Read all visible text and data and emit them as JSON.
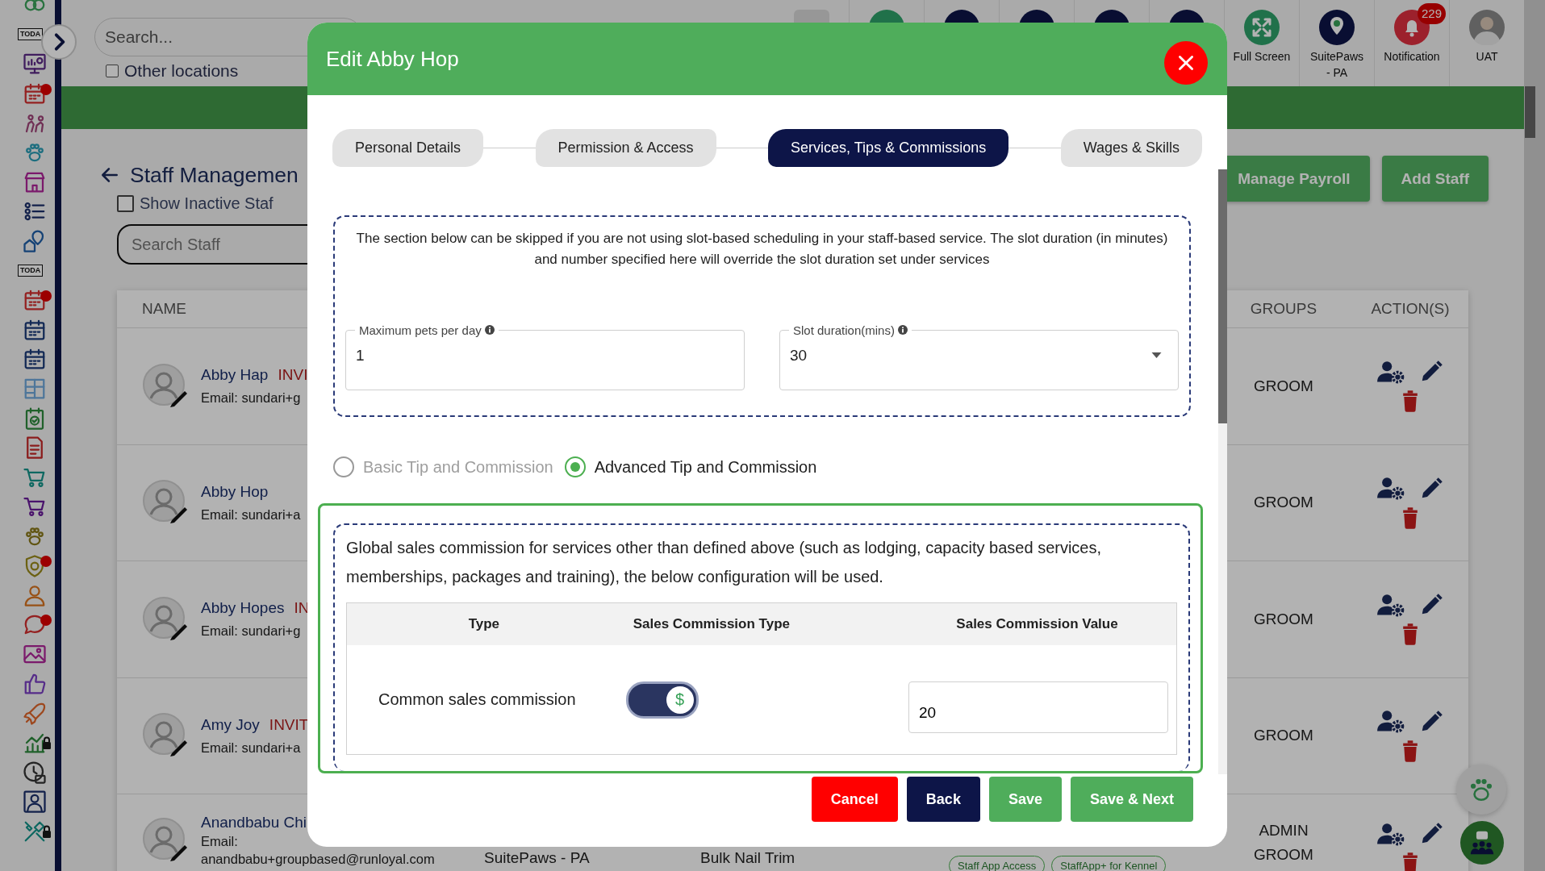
{
  "sidebar": {
    "items": [
      {
        "kind": "logo",
        "color": "#29723f",
        "alert": false,
        "locked": false
      },
      {
        "kind": "today",
        "label": "TODA",
        "color": "#0c0c0c",
        "alert": false,
        "locked": false
      },
      {
        "kind": "monitor",
        "color": "#401d5e",
        "alert": false,
        "locked": false
      },
      {
        "kind": "calendar",
        "color": "#942121",
        "alert": true,
        "locked": false
      },
      {
        "kind": "dogs",
        "color": "#703055",
        "alert": false,
        "locked": false
      },
      {
        "kind": "paw",
        "color": "#1d6e7f",
        "alert": false,
        "locked": false
      },
      {
        "kind": "shop",
        "color": "#7b1a6c",
        "alert": false,
        "locked": false
      },
      {
        "kind": "list",
        "color": "#13214b",
        "alert": false,
        "locked": false
      },
      {
        "kind": "pin",
        "color": "#164376",
        "alert": false,
        "locked": false
      },
      {
        "kind": "today",
        "label": "TODA",
        "color": "#0c0c0c",
        "alert": false,
        "locked": false
      },
      {
        "kind": "calendar",
        "color": "#942121",
        "alert": true,
        "locked": false
      },
      {
        "kind": "calendar",
        "color": "#132955",
        "alert": false,
        "locked": false
      },
      {
        "kind": "calendar",
        "color": "#132955",
        "alert": false,
        "locked": false
      },
      {
        "kind": "layout",
        "color": "#4e769a",
        "alert": false,
        "locked": false
      },
      {
        "kind": "checklist",
        "color": "#20612b",
        "alert": false,
        "locked": false
      },
      {
        "kind": "document",
        "color": "#8b1c1c",
        "alert": false,
        "locked": false
      },
      {
        "kind": "cart",
        "color": "#0e6861",
        "alert": false,
        "locked": false
      },
      {
        "kind": "cart",
        "color": "#4a136c",
        "alert": false,
        "locked": false
      },
      {
        "kind": "paw",
        "color": "#615512",
        "alert": false,
        "locked": false
      },
      {
        "kind": "shield",
        "color": "#6c6112",
        "alert": true,
        "locked": false
      },
      {
        "kind": "person",
        "color": "#985116",
        "alert": false,
        "locked": false
      },
      {
        "kind": "chat",
        "color": "#942121",
        "alert": true,
        "locked": false
      },
      {
        "kind": "image",
        "color": "#7b1a6c",
        "alert": false,
        "locked": false
      },
      {
        "kind": "thumbs",
        "color": "#562c89",
        "alert": false,
        "locked": false
      },
      {
        "kind": "rocket",
        "color": "#9d471d",
        "alert": false,
        "locked": false
      },
      {
        "kind": "chart",
        "color": "#20612b",
        "alert": false,
        "locked": true
      },
      {
        "kind": "clock",
        "color": "#242424",
        "alert": false,
        "locked": false
      },
      {
        "kind": "frame",
        "color": "#13214b",
        "alert": false,
        "locked": false
      },
      {
        "kind": "tools",
        "color": "#0e6861",
        "alert": false,
        "locked": true
      }
    ]
  },
  "topbar": {
    "search": {
      "placeholder": "Search..."
    },
    "other_locations": {
      "label": "Other locations",
      "checked": false
    },
    "tools": [
      {
        "kind": "square"
      },
      {
        "kind": "green_circle"
      },
      {
        "kind": "navy_circle"
      },
      {
        "kind": "navy_circle"
      },
      {
        "kind": "navy_circle"
      },
      {
        "kind": "navy_circle"
      },
      {
        "kind": "fullscreen",
        "label": "Full Screen"
      },
      {
        "kind": "location",
        "label": "SuitePaws - PA"
      },
      {
        "kind": "notification",
        "label": "Notification",
        "badge": "229"
      },
      {
        "kind": "avatar",
        "label": "UAT"
      }
    ]
  },
  "page": {
    "title": "Staff Managemen",
    "show_inactive": {
      "label": "Show Inactive Staf",
      "checked": false
    },
    "search": {
      "placeholder": "Search Staff"
    },
    "buttons": [
      "Manage Payroll",
      "Add Staff"
    ],
    "table": {
      "columns": [
        "NAME",
        "GROUPS",
        "ACTION(S)"
      ],
      "rows": [
        {
          "name": "Abby Hap",
          "status": "INVI",
          "email": [
            "Email: sundari+g"
          ],
          "groups": [
            "GROOM"
          ]
        },
        {
          "name": "Abby Hop",
          "email": [
            "Email: sundari+a"
          ],
          "groups": [
            "GROOM"
          ]
        },
        {
          "name": "Abby Hopes",
          "status": "IN",
          "email": [
            "Email: sundari+g"
          ],
          "groups": [
            "GROOM"
          ]
        },
        {
          "name": "Amy Joy",
          "status": "INVIT",
          "email": [
            "Email: sundari+a"
          ],
          "groups": [
            "GROOM"
          ]
        },
        {
          "name": "Anandbabu Chi",
          "email": [
            "Email:",
            "anandbabu+groupbased@runloyal.com"
          ],
          "location": "SuitePaws - PA",
          "service": "Bulk Nail Trim",
          "tags": [
            "Staff App Access",
            "StaffApp+ for Kennel"
          ],
          "groups": [
            "ADMIN",
            "GROOM"
          ]
        }
      ]
    }
  },
  "modal": {
    "title": "Edit Abby Hop",
    "tabs": [
      {
        "label": "Personal Details",
        "selected": false
      },
      {
        "label": "Permission & Access",
        "selected": false
      },
      {
        "label": "Services, Tips & Commissions",
        "selected": true
      },
      {
        "label": "Wages & Skills",
        "selected": false
      }
    ],
    "slot_note": "The section below can be skipped if you are not using slot-based scheduling in your staff-based service. The slot duration (in minutes) and number specified here will override the slot duration set under services",
    "max_pets": {
      "label": "Maximum pets per day",
      "value": "1"
    },
    "slot_duration": {
      "label": "Slot duration(mins)",
      "value": "30"
    },
    "tip_modes": [
      {
        "label": "Basic Tip and Commission",
        "selected": false
      },
      {
        "label": "Advanced Tip and Commission",
        "selected": true
      }
    ],
    "global_note": "Global sales commission for services other than defined above (such as lodging, capacity based services, memberships, packages and training), the below configuration will be used.",
    "commission_table": {
      "columns": [
        "Type",
        "Sales Commission Type",
        "Sales Commission Value"
      ],
      "rows": [
        {
          "type": "Common sales commission",
          "toggle": {
            "symbol": "$",
            "on": true
          },
          "value": "20"
        }
      ]
    },
    "buttons": [
      {
        "kind": "cancel",
        "label": "Cancel"
      },
      {
        "kind": "back",
        "label": "Back"
      },
      {
        "kind": "save",
        "label": "Save"
      },
      {
        "kind": "save",
        "label": "Save & Next"
      }
    ]
  }
}
